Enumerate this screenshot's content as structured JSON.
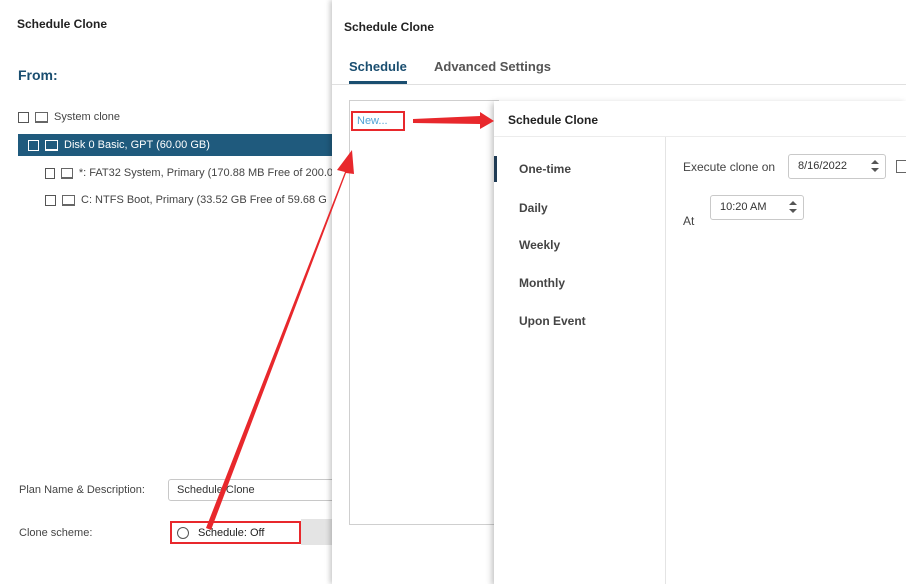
{
  "background_window": {
    "title": "Schedule Clone",
    "from_label": "From:",
    "tree": [
      {
        "label": "System clone"
      },
      {
        "label": "Disk 0 Basic, GPT (60.00 GB)"
      },
      {
        "label": "*: FAT32 System, Primary (170.88 MB Free of 200.0"
      },
      {
        "label": "C: NTFS Boot, Primary (33.52 GB Free of 59.68 G"
      }
    ],
    "plan_label": "Plan Name & Description:",
    "plan_value": "Schedule Clone",
    "scheme_label": "Clone scheme:",
    "scheme_button": "Schedule: Off"
  },
  "schedule_window": {
    "title": "Schedule Clone",
    "tabs": [
      {
        "label": "Schedule"
      },
      {
        "label": "Advanced Settings"
      }
    ],
    "new_link": "New..."
  },
  "detail_window": {
    "title": "Schedule Clone",
    "frequencies": [
      {
        "label": "One-time"
      },
      {
        "label": "Daily"
      },
      {
        "label": "Weekly"
      },
      {
        "label": "Monthly"
      },
      {
        "label": "Upon Event"
      }
    ],
    "execute_label": "Execute clone on",
    "date_value": "8/16/2022",
    "at_label": "At",
    "time_value": "10:20 AM"
  },
  "colors": {
    "accent": "#1a4e70",
    "selected_row": "#1f5a7d",
    "highlight_red": "#e8282c",
    "link": "#4fa3d5"
  }
}
